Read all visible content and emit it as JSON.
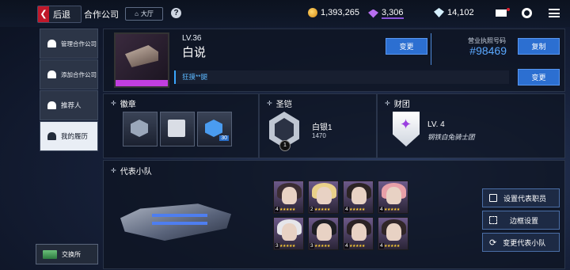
{
  "topbar": {
    "back_label": "后退",
    "title": "合作公司",
    "lobby_label": "大厅",
    "help_icon": "help-icon",
    "resources": {
      "credits": "1,393,265",
      "purple_gems": "3,306",
      "crystals": "14,102"
    }
  },
  "sidebar": {
    "items": [
      {
        "label": "管理合作公司",
        "icon": "people-icon"
      },
      {
        "label": "添加合作公司",
        "icon": "add-user-icon"
      },
      {
        "label": "推荐人",
        "icon": "user-icon"
      },
      {
        "label": "我的履历",
        "icon": "profile-card-icon"
      }
    ],
    "exchange_label": "交换所"
  },
  "profile": {
    "level": "LV.36",
    "name": "白说",
    "change_label": "变更",
    "license_label": "营业执照号码",
    "license_number": "#98469",
    "copy_label": "复制",
    "signature": "狂摸**腿",
    "signature_change_label": "变更"
  },
  "badges": {
    "title": "徽章",
    "items": [
      {
        "icon": "skull-badge-icon",
        "number": ""
      },
      {
        "icon": "book-badge-icon",
        "number": ""
      },
      {
        "icon": "gem-badge-icon",
        "number": "30"
      }
    ]
  },
  "emblem": {
    "title": "圣铠",
    "rank": "白银1",
    "points": "1470",
    "level_mark": "1"
  },
  "guild": {
    "title": "财团",
    "level": "LV. 4",
    "name": "钢铁白兔骑士团"
  },
  "squad": {
    "title": "代表小队",
    "members": [
      {
        "rank": "4",
        "hair": "#3b2d33"
      },
      {
        "rank": "2",
        "hair": "#e9d08a"
      },
      {
        "rank": "4",
        "hair": "#2c2424"
      },
      {
        "rank": "4",
        "hair": "#e8a0a8"
      },
      {
        "rank": "3",
        "hair": "#e6e6ea"
      },
      {
        "rank": "3",
        "hair": "#1e1e24"
      },
      {
        "rank": "4",
        "hair": "#2a2224"
      },
      {
        "rank": "4",
        "hair": "#312628"
      }
    ],
    "buttons": {
      "set_rep": "设置代表职员",
      "frame": "边框设置",
      "change_squad": "变更代表小队"
    }
  },
  "colors": {
    "accent_blue": "#2c6fd1",
    "back_red": "#c0182a",
    "license_blue": "#5aa8ff"
  }
}
